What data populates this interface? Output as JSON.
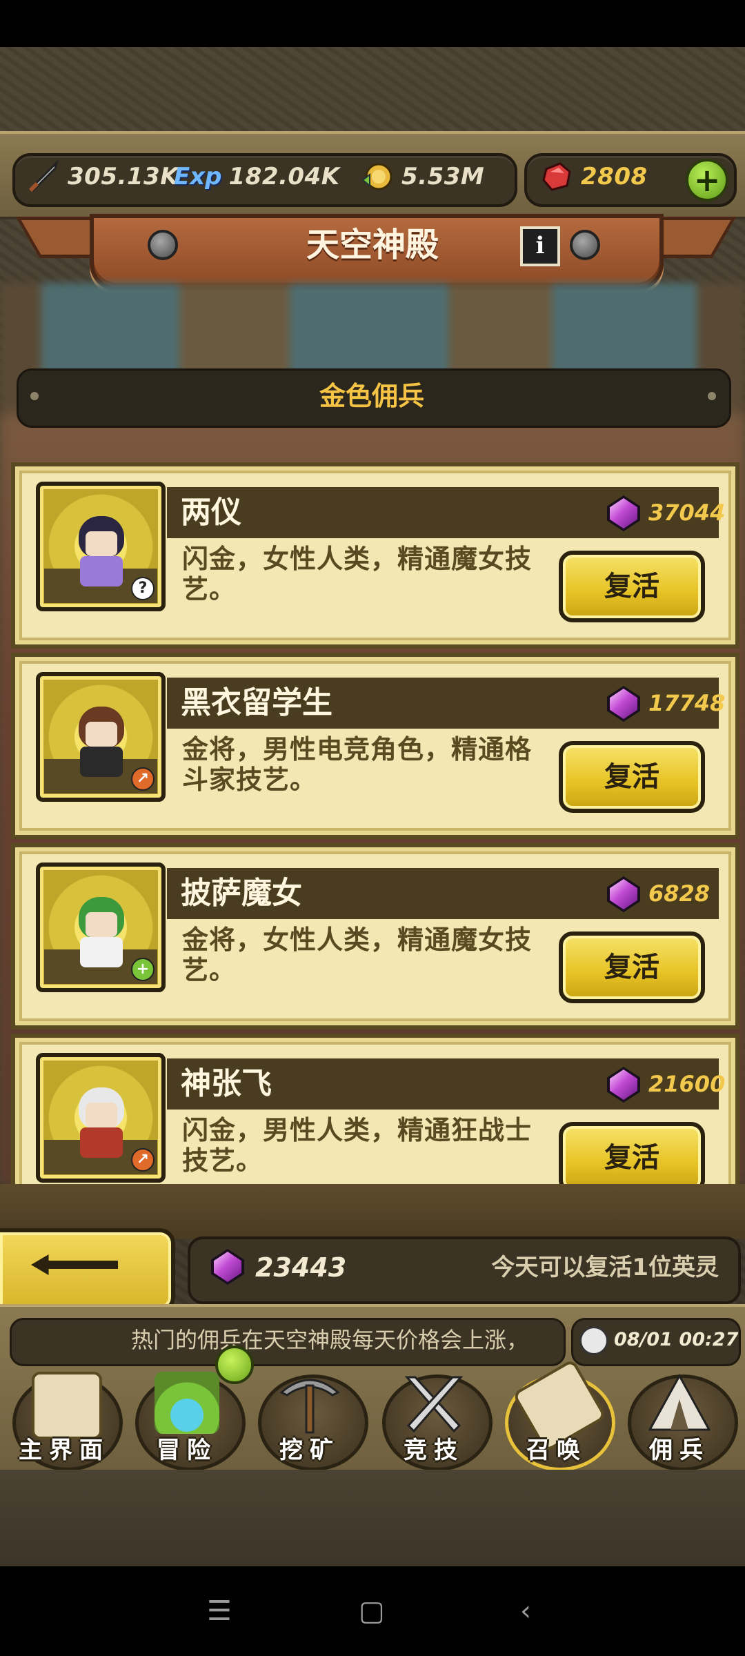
{
  "resources": {
    "attack": "305.13K",
    "exp_icon_text": "Exp",
    "exp": "182.04K",
    "gold": "5.53M",
    "rubies": "2808"
  },
  "title": "天空神殿",
  "info_label": "i",
  "category": "金色佣兵",
  "heroes": [
    {
      "name": "两仪",
      "price": "37044",
      "desc": "闪金，女性人类，精通魔女技艺。",
      "button": "复活",
      "badge": "?",
      "hair": "#2a2540",
      "body": "#9a7ad8",
      "badge_color": "#ffffff"
    },
    {
      "name": "黑衣留学生",
      "price": "17748",
      "desc": "金将，男性电竞角色，精通格斗家技艺。",
      "button": "复活",
      "badge": "↗",
      "hair": "#6a3a22",
      "body": "#2a2a2a",
      "badge_color": "#e06a2a"
    },
    {
      "name": "披萨魔女",
      "price": "6828",
      "desc": "金将，女性人类，精通魔女技艺。",
      "button": "复活",
      "badge": "+",
      "hair": "#3c9a3c",
      "body": "#f2f2f2",
      "badge_color": "#7ac43a"
    },
    {
      "name": "神张飞",
      "price": "21600",
      "desc": "闪金，男性人类，精通狂战士技艺。",
      "button": "复活",
      "badge": "↗",
      "hair": "#e8e8e8",
      "body": "#b23a2a",
      "badge_color": "#e06a2a"
    }
  ],
  "footer": {
    "gems": "23443",
    "note": "今天可以复活1位英灵"
  },
  "ticker": "热门的佣兵在天空神殿每天价格会上涨，",
  "clock": "08/01 00:27",
  "nav": [
    {
      "label": "主界面",
      "icon": "scroll-map-icon"
    },
    {
      "label": "冒险",
      "icon": "island-icon"
    },
    {
      "label": "挖矿",
      "icon": "pickaxe-icon"
    },
    {
      "label": "竞技",
      "icon": "crossed-swords-icon"
    },
    {
      "label": "召唤",
      "icon": "summon-scroll-icon"
    },
    {
      "label": "佣兵",
      "icon": "tent-icon"
    }
  ],
  "colors": {
    "gold_text": "#f2c94c",
    "card_bg": "#f3e7b3",
    "button_yellow": "#e6c224"
  }
}
